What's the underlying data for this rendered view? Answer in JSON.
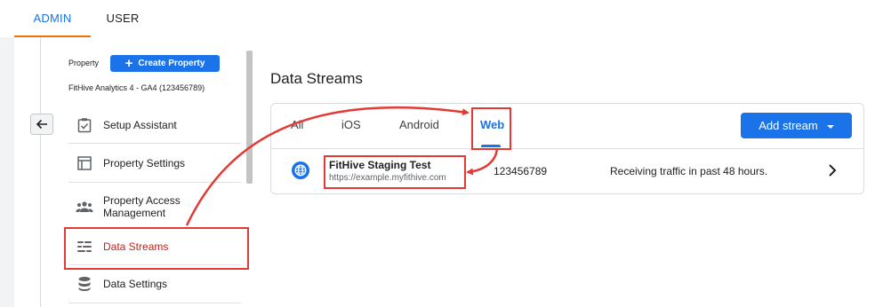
{
  "top_tabs": {
    "admin": "ADMIN",
    "user": "USER"
  },
  "property": {
    "label": "Property",
    "create_button": "Create Property",
    "account_name": "FitHive Analytics 4 - GA4 (123456789)"
  },
  "sidebar": {
    "items": [
      {
        "label": "Setup Assistant",
        "icon": "checklist-icon"
      },
      {
        "label": "Property Settings",
        "icon": "layout-icon"
      },
      {
        "label": "Property Access Management",
        "icon": "people-icon"
      },
      {
        "label": "Data Streams",
        "icon": "data-streams-icon",
        "active": true
      },
      {
        "label": "Data Settings",
        "icon": "database-icon"
      }
    ]
  },
  "main": {
    "title": "Data Streams",
    "tabs": [
      "All",
      "iOS",
      "Android",
      "Web"
    ],
    "selected_tab": "Web",
    "add_stream_label": "Add stream",
    "streams": [
      {
        "name": "FitHive Staging Test",
        "url": "https://example.myfithive.com",
        "id": "123456789",
        "status": "Receiving traffic in past 48 hours."
      }
    ]
  },
  "colors": {
    "accent": "#1a73e8",
    "annotation": "#e53935",
    "active_nav": "#c5221f",
    "tab_underline": "#e8710a"
  }
}
